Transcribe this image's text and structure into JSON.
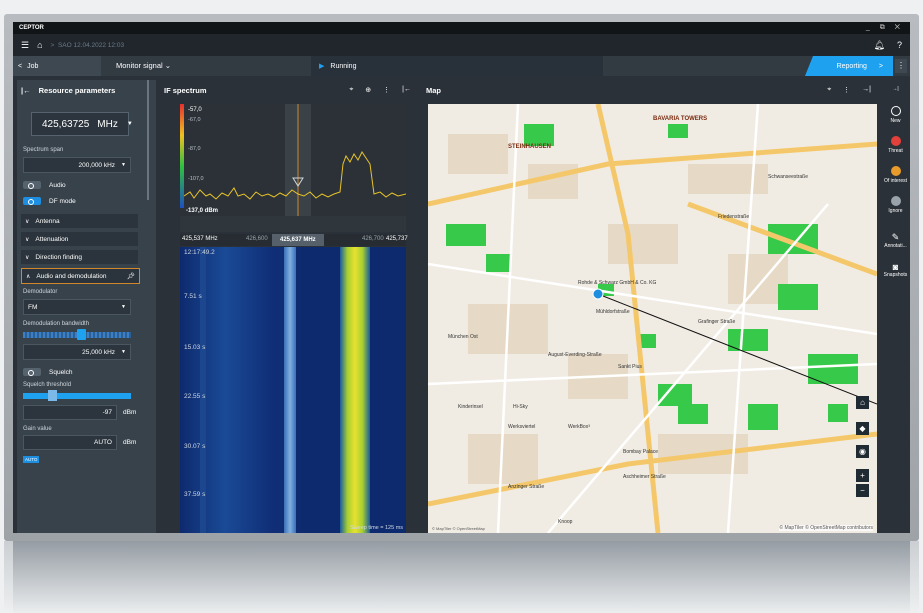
{
  "app": {
    "brand": "CEPTOR",
    "window_controls": "_ ⧉ ✕"
  },
  "topbar": {
    "breadcrumb": "SAO 12.04.2022 12:03"
  },
  "tabs": {
    "job_label": "Job",
    "monitor_label": "Monitor signal",
    "running_label": "Running",
    "reporting_label": "Reporting"
  },
  "resource_panel": {
    "title": "Resource parameters",
    "frequency_value": "425,63725",
    "frequency_unit": "MHz",
    "spectrum_span_label": "Spectrum span",
    "spectrum_span_value": "200,000 kHz",
    "audio_label": "Audio",
    "df_mode_label": "DF mode",
    "sections": [
      "Antenna",
      "Attenuation",
      "Direction finding"
    ],
    "audio_section_label": "Audio and demodulation",
    "demodulator_label": "Demodulator",
    "demodulator_value": "FM",
    "demod_bandwidth_label": "Demodulation bandwidth",
    "demod_bandwidth_value": "25,000 kHz",
    "squelch_label": "Squelch",
    "squelch_threshold_label": "Squelch threshold",
    "squelch_threshold_value": "-97",
    "squelch_threshold_unit": "dBm",
    "gain_label": "Gain value",
    "gain_value": "AUTO",
    "gain_unit": "dBm",
    "auto_badge": "AUTO"
  },
  "if_spectrum": {
    "title": "IF spectrum",
    "level_ticks": [
      "-57,0",
      "-67,0",
      "-87,0",
      "-107,0"
    ],
    "bottom_level": "-137,0 dBm",
    "freq_axis": {
      "left": "425,537 MHz",
      "t1": "426,600",
      "center": "425,637 MHz",
      "t2": "426,700",
      "right": "425,737"
    },
    "waterfall_times": [
      "12:17:49.2",
      "7.51 s",
      "15.03 s",
      "22.55 s",
      "30.07 s",
      "37.59 s"
    ],
    "sweep_time": "Sweep time = 125 ms"
  },
  "map": {
    "title": "Map",
    "labels": [
      "BAVARIA TOWERS",
      "STEINHAUSEN",
      "Rohde & Schwarz GmbH & Co. KG",
      "Mühldorfstraße",
      "August-Everding-Straße",
      "Bombay Palace",
      "Aschheimer Straße",
      "Knoop",
      "Werksviertel",
      "Sankt Pius",
      "Kinderinsel",
      "Hi-Sky",
      "WerkBox³",
      "Grafinger Straße",
      "Anzinger Straße",
      "Schwanseestraße",
      "Friedenstraße",
      "München Ost"
    ],
    "attribution": "© MapTiler © OpenStreetMap contributors",
    "attribution_left": "© MapTiler © OpenStreetMap"
  },
  "right_bar": {
    "items": [
      "New",
      "Threat",
      "Of interest",
      "Ignore",
      "Annotati...",
      "Snapshots"
    ]
  },
  "colors": {
    "accent": "#1ea2f0",
    "threat": "#e2403a",
    "of_interest": "#e89b2b",
    "ignore": "#9aa3ab"
  }
}
